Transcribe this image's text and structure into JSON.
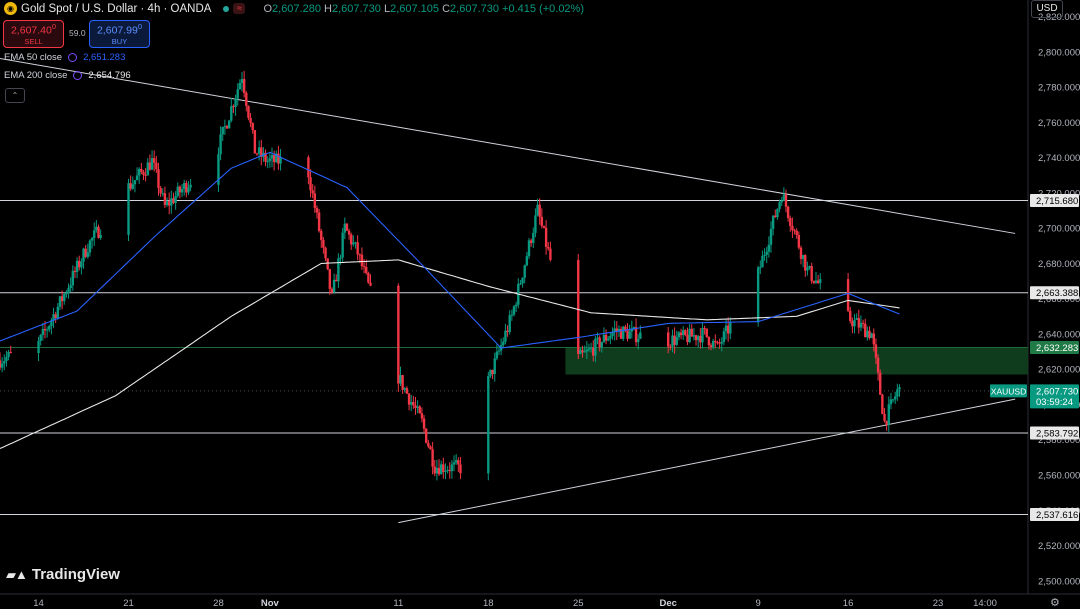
{
  "header": {
    "title": "Gold Spot / U.S. Dollar · 4h · OANDA",
    "mini_badge": "≈",
    "ohlc": [
      {
        "k": "O",
        "v": "2,607.280"
      },
      {
        "k": "H",
        "v": "2,607.730"
      },
      {
        "k": "L",
        "v": "2,607.105"
      },
      {
        "k": "C",
        "v": "2,607.730"
      }
    ],
    "change": "+0.415 (+0.02%)"
  },
  "trade": {
    "sell_price": "2,607.40",
    "sell_sup": "0",
    "sell_label": "SELL",
    "buy_price": "2,607.99",
    "buy_sup": "0",
    "buy_label": "BUY",
    "spread": "59.0"
  },
  "indicators": [
    {
      "label": "EMA 50 close",
      "value": "2,651.283",
      "color": "#2962ff"
    },
    {
      "label": "EMA 200 close",
      "value": "2,654.796",
      "color": "#e8e8e8"
    }
  ],
  "currency": "USD",
  "brand": "TradingView",
  "chart_data": {
    "type": "candlestick",
    "symbol": "XAUUSD",
    "y_ticks": [
      2500,
      2520,
      2540,
      2560,
      2580,
      2600,
      2620,
      2640,
      2660,
      2680,
      2700,
      2720,
      2740,
      2760,
      2780,
      2800,
      2820
    ],
    "y_tick_labels": [
      "2,500.000",
      "2,520.000",
      "2,540.000",
      "2,560.000",
      "2,580.000",
      "2,600.000",
      "2,620.000",
      "2,640.000",
      "2,660.000",
      "2,680.000",
      "2,700.000",
      "2,720.000",
      "2,740.000",
      "2,760.000",
      "2,780.000",
      "2,800.000",
      "2,820.000"
    ],
    "x_ticks": [
      "14",
      "21",
      "28",
      "Nov",
      "11",
      "18",
      "25",
      "Dec",
      "9",
      "16",
      "23",
      "14:00"
    ],
    "price_path": [
      [
        "2024-10-11",
        2625
      ],
      [
        "2024-10-14",
        2632
      ],
      [
        "2024-10-16",
        2660
      ],
      [
        "2024-10-18",
        2690
      ],
      [
        "2024-10-21",
        2722
      ],
      [
        "2024-10-23",
        2738
      ],
      [
        "2024-10-24",
        2712
      ],
      [
        "2024-10-28",
        2742
      ],
      [
        "2024-10-30",
        2787
      ],
      [
        "2024-10-31",
        2744
      ],
      [
        "2024-11-01",
        2738
      ],
      [
        "2024-11-04",
        2738
      ],
      [
        "2024-11-06",
        2660
      ],
      [
        "2024-11-07",
        2700
      ],
      [
        "2024-11-08",
        2686
      ],
      [
        "2024-11-11",
        2618
      ],
      [
        "2024-11-13",
        2590
      ],
      [
        "2024-11-14",
        2565
      ],
      [
        "2024-11-16",
        2564
      ],
      [
        "2024-11-18",
        2610
      ],
      [
        "2024-11-20",
        2650
      ],
      [
        "2024-11-22",
        2710
      ],
      [
        "2024-11-25",
        2625
      ],
      [
        "2024-11-26",
        2630
      ],
      [
        "2024-11-28",
        2642
      ],
      [
        "2024-12-02",
        2636
      ],
      [
        "2024-12-05",
        2640
      ],
      [
        "2024-12-06",
        2632
      ],
      [
        "2024-12-09",
        2670
      ],
      [
        "2024-12-11",
        2720
      ],
      [
        "2024-12-13",
        2676
      ],
      [
        "2024-12-16",
        2650
      ],
      [
        "2024-12-18",
        2640
      ],
      [
        "2024-12-19",
        2590
      ],
      [
        "2024-12-20",
        2607.73
      ]
    ],
    "ema50_path": [
      [
        "2024-10-11",
        2636
      ],
      [
        "2024-10-17",
        2653
      ],
      [
        "2024-10-23",
        2695
      ],
      [
        "2024-10-29",
        2734
      ],
      [
        "2024-11-01",
        2743
      ],
      [
        "2024-11-07",
        2723
      ],
      [
        "2024-11-13",
        2678
      ],
      [
        "2024-11-19",
        2632
      ],
      [
        "2024-11-25",
        2638
      ],
      [
        "2024-12-02",
        2646
      ],
      [
        "2024-12-09",
        2647
      ],
      [
        "2024-12-16",
        2663
      ],
      [
        "2024-12-20",
        2651.283
      ]
    ],
    "ema200_path": [
      [
        "2024-10-11",
        2575
      ],
      [
        "2024-10-20",
        2605
      ],
      [
        "2024-10-29",
        2650
      ],
      [
        "2024-11-05",
        2680
      ],
      [
        "2024-11-11",
        2682
      ],
      [
        "2024-11-18",
        2667
      ],
      [
        "2024-11-26",
        2652
      ],
      [
        "2024-12-05",
        2648
      ],
      [
        "2024-12-12",
        2650
      ],
      [
        "2024-12-16",
        2659
      ],
      [
        "2024-12-20",
        2654.796
      ]
    ],
    "horizontal_levels": [
      {
        "price": 2715.68,
        "label": "2,715.680"
      },
      {
        "price": 2663.388,
        "label": "2,663.388"
      },
      {
        "price": 2583.792,
        "label": "2,583.792"
      },
      {
        "price": 2537.616,
        "label": "2,537.616"
      }
    ],
    "demand_zone": {
      "from_date": "2024-11-24",
      "low": 2617,
      "high": 2632.283,
      "label": "2,632.283",
      "color": "#0f3f1f"
    },
    "trendlines": [
      {
        "from": [
          "2024-10-04",
          2805
        ],
        "to": [
          "2024-12-29",
          2697
        ]
      },
      {
        "from": [
          "2024-11-11",
          2533
        ],
        "to": [
          "2024-12-29",
          2603
        ]
      }
    ],
    "last_price": {
      "symbol": "XAUUSD",
      "value": "2,607.730",
      "countdown": "03:59:24",
      "color": "#089981"
    },
    "colors": {
      "up": "#089981",
      "down": "#f23645",
      "ema50": "#2962ff",
      "ema200": "#e8e8e8"
    }
  }
}
